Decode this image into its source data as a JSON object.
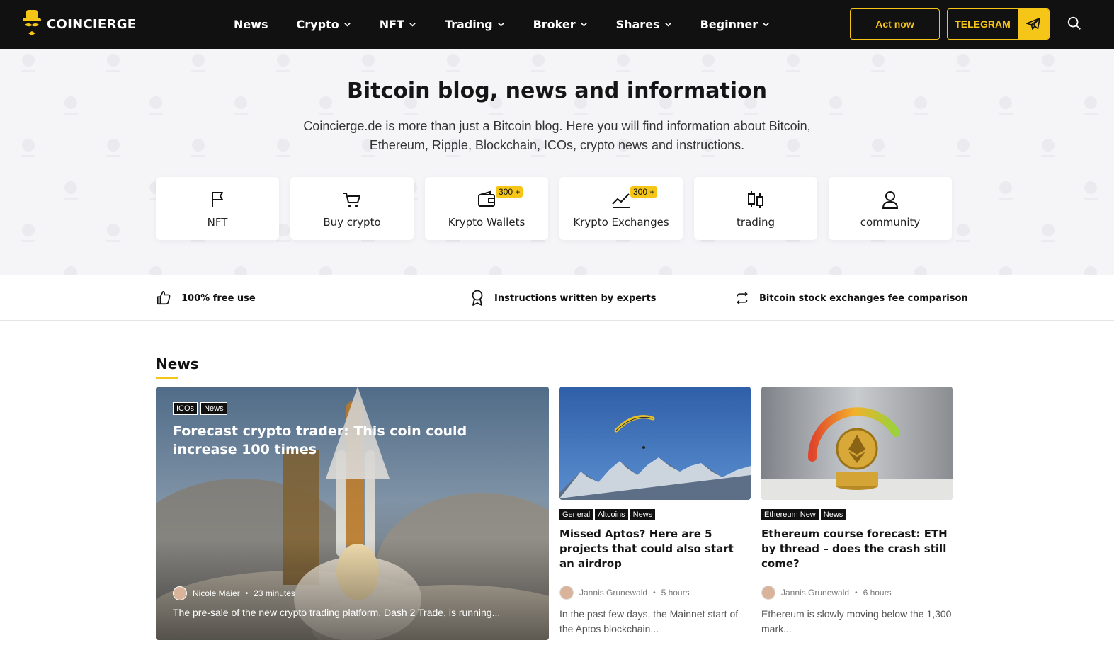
{
  "header": {
    "logo_text": "COINCIERGE",
    "nav": [
      {
        "label": "News",
        "has_dropdown": false
      },
      {
        "label": "Crypto",
        "has_dropdown": true
      },
      {
        "label": "NFT",
        "has_dropdown": true
      },
      {
        "label": "Trading",
        "has_dropdown": true
      },
      {
        "label": "Broker",
        "has_dropdown": true
      },
      {
        "label": "Shares",
        "has_dropdown": true
      },
      {
        "label": "Beginner",
        "has_dropdown": true
      }
    ],
    "act_now_label": "Act now",
    "telegram_label": "TELEGRAM",
    "accent_color": "#f5c518"
  },
  "hero": {
    "title": "Bitcoin blog, news and information",
    "subtitle": "Coincierge.de is more than just a Bitcoin blog. Here you will find information about Bitcoin, Ethereum, Ripple, Blockchain, ICOs, crypto news and instructions.",
    "categories": [
      {
        "label": "NFT",
        "icon": "flag-icon",
        "badge": ""
      },
      {
        "label": "Buy crypto",
        "icon": "cart-icon",
        "badge": ""
      },
      {
        "label": "Krypto Wallets",
        "icon": "wallet-icon",
        "badge": "300 +"
      },
      {
        "label": "Krypto Exchanges",
        "icon": "chart-line-icon",
        "badge": "300 +"
      },
      {
        "label": "trading",
        "icon": "candles-icon",
        "badge": ""
      },
      {
        "label": "community",
        "icon": "user-icon",
        "badge": ""
      }
    ]
  },
  "features": [
    {
      "label": "100% free use",
      "icon": "thumbs-up-icon"
    },
    {
      "label": "Instructions written by experts",
      "icon": "award-icon"
    },
    {
      "label": "Bitcoin stock exchanges fee comparison",
      "icon": "exchange-icon"
    }
  ],
  "news": {
    "section_title": "News",
    "main": {
      "tags": [
        "ICOs",
        "News"
      ],
      "headline": "Forecast crypto trader: This coin could increase 100 times",
      "author": "Nicole Maier",
      "time": "23 minutes",
      "excerpt": "The pre-sale of the new crypto trading platform, Dash 2 Trade, is running..."
    },
    "side": [
      {
        "tags": [
          "General",
          "Altcoins",
          "News"
        ],
        "headline": "Missed Aptos? Here are 5 projects that could also start an airdrop",
        "author": "Jannis Grunewald",
        "time": "5 hours",
        "excerpt": "In the past few days, the Mainnet start of the Aptos blockchain..."
      },
      {
        "tags": [
          "Ethereum New",
          "News"
        ],
        "headline": "Ethereum course forecast: ETH by thread – does the crash still come?",
        "author": "Jannis Grunewald",
        "time": "6 hours",
        "excerpt": "Ethereum is slowly moving below the 1,300 mark..."
      }
    ]
  }
}
